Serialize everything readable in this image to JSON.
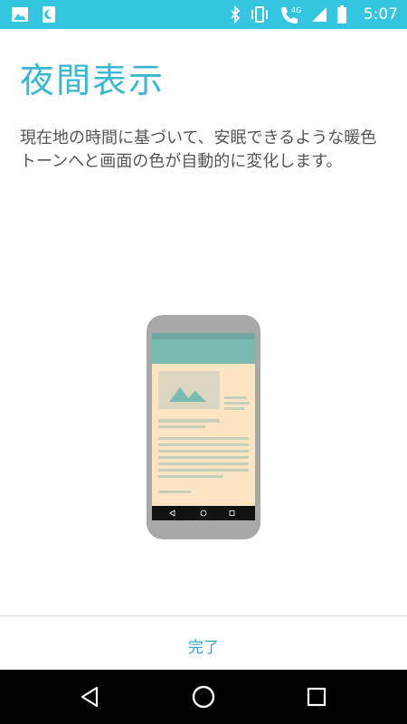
{
  "status_bar": {
    "time": "5:07",
    "network_label": "4G",
    "left_icons": [
      "image-icon",
      "night-moon-icon"
    ],
    "right_icons": [
      "bluetooth-icon",
      "vibrate-icon",
      "volte-call-icon",
      "signal-icon",
      "battery-icon"
    ],
    "color": "#34c5e0"
  },
  "page": {
    "title": "夜間表示",
    "description": "現在地の時間に基づいて、安眠できるような暖色トーンへと画面の色が自動的に変化します。",
    "accent_color": "#3bb6d4"
  },
  "illustration": {
    "nav_icons": [
      "back-triangle-icon",
      "home-circle-icon",
      "recents-square-icon"
    ]
  },
  "footer": {
    "done_label": "完了"
  },
  "nav_bar": {
    "buttons": [
      "back",
      "home",
      "recents"
    ]
  }
}
